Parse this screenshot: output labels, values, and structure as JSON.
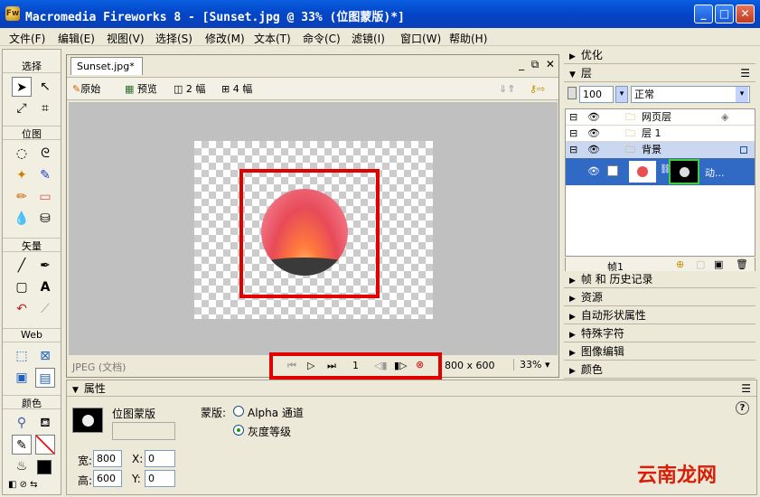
{
  "window": {
    "title": "Macromedia Fireworks 8 - [Sunset.jpg @  33% (位图蒙版)*]",
    "app_icon": "fireworks-icon",
    "controls": [
      "minimize",
      "maximize",
      "close"
    ]
  },
  "menu": [
    "文件(F)",
    "编辑(E)",
    "视图(V)",
    "选择(S)",
    "修改(M)",
    "文本(T)",
    "命令(C)",
    "滤镜(I)",
    "窗口(W)",
    "帮助(H)"
  ],
  "tools": {
    "sections": [
      "选择",
      "位图",
      "矢量",
      "Web",
      "颜色"
    ]
  },
  "document": {
    "tab_label": "Sunset.jpg*",
    "view_tabs": [
      "原始",
      "预览",
      "2 幅",
      "4 幅"
    ],
    "status_type": "JPEG (文档)",
    "frame_number": "1",
    "dimensions": "800 x 600",
    "zoom": "33%"
  },
  "right_panels": {
    "optimize": "优化",
    "layers": "层",
    "opacity": "100",
    "blend_mode": "正常",
    "layer_rows": [
      {
        "name": "网页层"
      },
      {
        "name": "层 1"
      },
      {
        "name": "背景"
      }
    ],
    "object_label": "动...",
    "frame_label": "帧1",
    "collapsed": [
      "帧 和 历史记录",
      "资源",
      "自动形状属性",
      "特殊字符",
      "图像编辑",
      "颜色"
    ]
  },
  "properties": {
    "header": "属性",
    "object_type": "位图蒙版",
    "mask_label": "蒙版:",
    "option_alpha": "Alpha 通道",
    "option_gray": "灰度等级",
    "width_label": "宽:",
    "width_value": "800",
    "height_label": "高:",
    "height_value": "600",
    "x_label": "X:",
    "x_value": "0",
    "y_label": "Y:",
    "y_value": "0",
    "help": "?"
  },
  "watermark": "云南龙网",
  "colors": {
    "titlebar": "#0347c9",
    "highlight_red": "#e00000",
    "selected_layer": "#316ac5"
  }
}
